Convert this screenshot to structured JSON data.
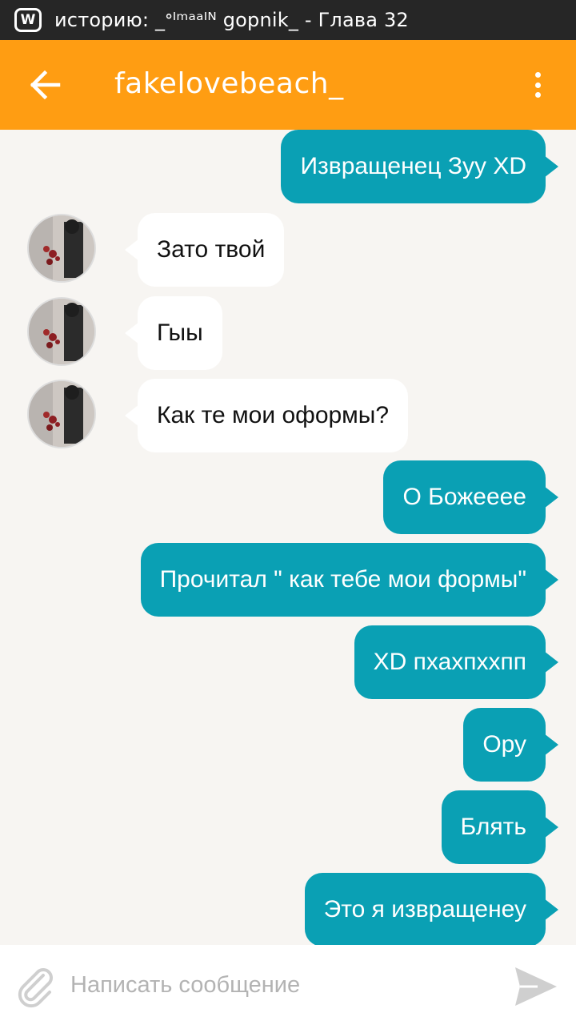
{
  "status_bar": {
    "app_icon": "W",
    "notification_text": "историю: _ᐤᴵᵐᵃᵃᴵᴺ gopnik_ - Глава 32"
  },
  "header": {
    "title": "fakelovebeach_",
    "back_icon": "arrow-left-icon",
    "menu_icon": "more-vertical-icon"
  },
  "messages": [
    {
      "side": "out",
      "text": "Извращенец Зуу XD"
    },
    {
      "side": "in",
      "text": "Зато твой"
    },
    {
      "side": "in",
      "text": "Гыы"
    },
    {
      "side": "in",
      "text": "Как те мои оформы?"
    },
    {
      "side": "out",
      "text": "О Божееее"
    },
    {
      "side": "out",
      "text": "Прочитал \" как тебе мои формы\""
    },
    {
      "side": "out",
      "text": "XD пхахпххпп"
    },
    {
      "side": "out",
      "text": "Ору"
    },
    {
      "side": "out",
      "text": "Блять"
    },
    {
      "side": "out",
      "text": "Это я извращенеу"
    }
  ],
  "composer": {
    "placeholder": "Написать сообщение",
    "value": "",
    "attach_icon": "paperclip-icon",
    "send_icon": "send-icon"
  },
  "colors": {
    "header": "#ff9d12",
    "outgoing_bubble": "#0aa0b4",
    "incoming_bubble": "#ffffff",
    "background": "#f7f5f2",
    "status_bar": "#262626"
  }
}
